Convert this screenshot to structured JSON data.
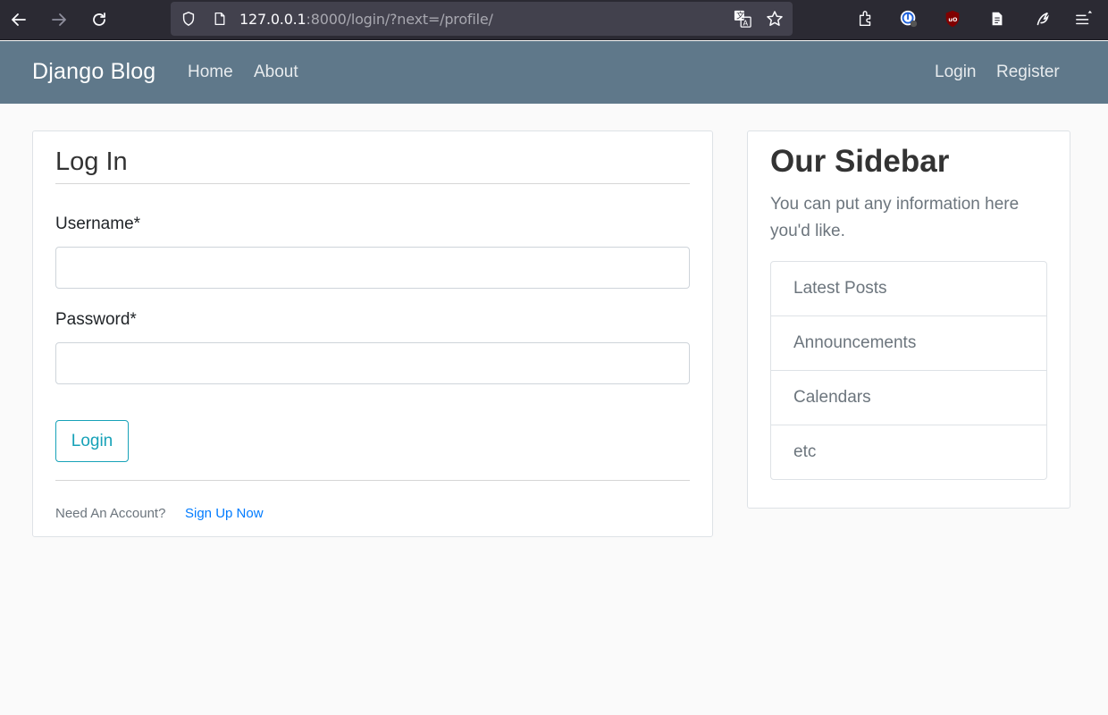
{
  "browser": {
    "url_host": "127.0.0.1",
    "url_rest": ":8000/login/?next=/profile/",
    "icons": [
      "back-icon",
      "forward-icon",
      "reload-icon",
      "shield-icon",
      "page-icon",
      "translate-icon",
      "star-icon",
      "extensions-icon",
      "password-manager-icon",
      "ublock-icon",
      "reader-icon",
      "sync-icon",
      "menu-icon"
    ]
  },
  "navbar": {
    "brand": "Django Blog",
    "links": [
      "Home",
      "About"
    ],
    "right_links": [
      "Login",
      "Register"
    ],
    "bg_color": "#5f788a"
  },
  "login": {
    "title": "Log In",
    "username_label": "Username*",
    "username_value": "",
    "password_label": "Password*",
    "password_value": "",
    "submit_label": "Login",
    "footer_text": "Need An Account?",
    "footer_link": "Sign Up Now",
    "accent_color": "#17a2b8",
    "link_color": "#007bff"
  },
  "sidebar": {
    "title": "Our Sidebar",
    "text": "You can put any information here you'd like.",
    "items": [
      "Latest Posts",
      "Announcements",
      "Calendars",
      "etc"
    ]
  }
}
